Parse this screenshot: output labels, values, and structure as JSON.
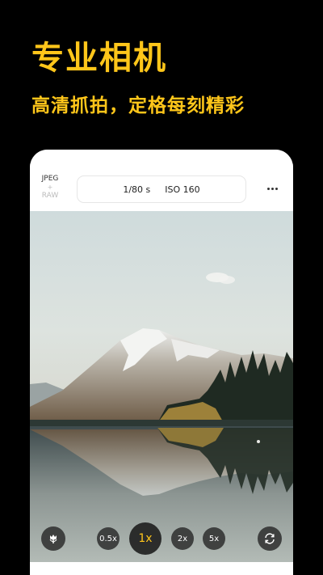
{
  "promo": {
    "headline": "专业相机",
    "subline": "高清抓拍，定格每刻精彩"
  },
  "camera": {
    "format_primary": "JPEG",
    "format_plus": "+",
    "format_secondary": "RAW",
    "shutter": "1/80 s",
    "iso": "ISO 160",
    "zoom_options": [
      "0.5x",
      "1x",
      "2x",
      "5x"
    ],
    "zoom_selected": "1x"
  },
  "icons": {
    "more": "more-dots-icon",
    "macro": "tulip-macro-icon",
    "switch_camera": "switch-camera-icon"
  },
  "colors": {
    "accent": "#FFC61A",
    "background": "#000000"
  }
}
